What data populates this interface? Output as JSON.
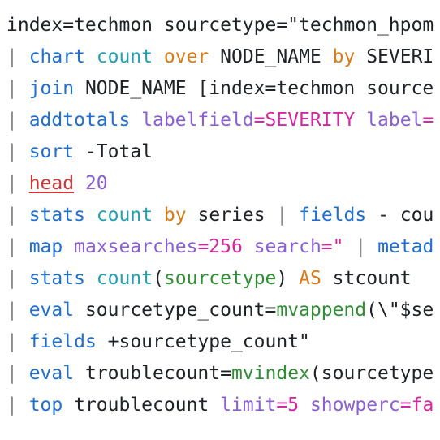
{
  "editor": {
    "lines": [
      {
        "tokens": [
          {
            "text": "index=techmon sourcetype=\"techmon_hpom",
            "role": "plain"
          }
        ]
      },
      {
        "tokens": [
          {
            "text": "| ",
            "role": "pipe"
          },
          {
            "text": "chart",
            "role": "cmd"
          },
          {
            "text": " ",
            "role": "plain"
          },
          {
            "text": "count",
            "role": "fn"
          },
          {
            "text": " ",
            "role": "plain"
          },
          {
            "text": "over",
            "role": "kw"
          },
          {
            "text": " NODE_NAME ",
            "role": "plain"
          },
          {
            "text": "by",
            "role": "kw"
          },
          {
            "text": " SEVERI",
            "role": "plain"
          }
        ]
      },
      {
        "tokens": [
          {
            "text": "| ",
            "role": "pipe"
          },
          {
            "text": "join",
            "role": "cmd"
          },
          {
            "text": " NODE_NAME [index=techmon source",
            "role": "plain"
          }
        ]
      },
      {
        "tokens": [
          {
            "text": "| ",
            "role": "pipe"
          },
          {
            "text": "addtotals",
            "role": "cmd"
          },
          {
            "text": " ",
            "role": "plain"
          },
          {
            "text": "labelfield",
            "role": "arg"
          },
          {
            "text": "=",
            "role": "op"
          },
          {
            "text": "SEVERITY",
            "role": "op"
          },
          {
            "text": " ",
            "role": "plain"
          },
          {
            "text": "label",
            "role": "arg"
          },
          {
            "text": "=",
            "role": "op"
          }
        ]
      },
      {
        "tokens": [
          {
            "text": "| ",
            "role": "pipe"
          },
          {
            "text": "sort",
            "role": "cmd"
          },
          {
            "text": " -Total",
            "role": "plain"
          }
        ]
      },
      {
        "tokens": [
          {
            "text": "| ",
            "role": "pipe"
          },
          {
            "text": "head",
            "role": "head"
          },
          {
            "text": " ",
            "role": "plain"
          },
          {
            "text": "20",
            "role": "num"
          }
        ]
      },
      {
        "tokens": [
          {
            "text": "| ",
            "role": "pipe"
          },
          {
            "text": "stats",
            "role": "cmd"
          },
          {
            "text": " ",
            "role": "plain"
          },
          {
            "text": "count",
            "role": "fn"
          },
          {
            "text": " ",
            "role": "plain"
          },
          {
            "text": "by",
            "role": "kw"
          },
          {
            "text": " series ",
            "role": "plain"
          },
          {
            "text": "|",
            "role": "pipe"
          },
          {
            "text": " ",
            "role": "plain"
          },
          {
            "text": "fields",
            "role": "cmd"
          },
          {
            "text": " - cou",
            "role": "plain"
          }
        ]
      },
      {
        "tokens": [
          {
            "text": "| ",
            "role": "pipe"
          },
          {
            "text": "map",
            "role": "cmd"
          },
          {
            "text": " ",
            "role": "plain"
          },
          {
            "text": "maxsearches",
            "role": "arg"
          },
          {
            "text": "=",
            "role": "op"
          },
          {
            "text": "256",
            "role": "op"
          },
          {
            "text": " ",
            "role": "plain"
          },
          {
            "text": "search",
            "role": "arg"
          },
          {
            "text": "=",
            "role": "op"
          },
          {
            "text": "\" ",
            "role": "op"
          },
          {
            "text": "|",
            "role": "pipe"
          },
          {
            "text": " ",
            "role": "plain"
          },
          {
            "text": "metad",
            "role": "cmd"
          }
        ]
      },
      {
        "tokens": [
          {
            "text": "| ",
            "role": "pipe"
          },
          {
            "text": "stats",
            "role": "cmd"
          },
          {
            "text": " ",
            "role": "plain"
          },
          {
            "text": "count",
            "role": "fn"
          },
          {
            "text": "(",
            "role": "plain"
          },
          {
            "text": "sourcetype",
            "role": "eval-fn"
          },
          {
            "text": ") ",
            "role": "plain"
          },
          {
            "text": "AS",
            "role": "kw"
          },
          {
            "text": " stcount",
            "role": "plain"
          }
        ]
      },
      {
        "tokens": [
          {
            "text": "| ",
            "role": "pipe"
          },
          {
            "text": "eval",
            "role": "cmd"
          },
          {
            "text": " sourcetype_count=",
            "role": "plain"
          },
          {
            "text": "mvappend",
            "role": "eval-fn"
          },
          {
            "text": "(\\\"$se",
            "role": "plain"
          }
        ]
      },
      {
        "tokens": [
          {
            "text": "| ",
            "role": "pipe"
          },
          {
            "text": "fields",
            "role": "cmd"
          },
          {
            "text": " +sourcetype_count\"",
            "role": "plain"
          }
        ]
      },
      {
        "tokens": [
          {
            "text": "| ",
            "role": "pipe"
          },
          {
            "text": "eval",
            "role": "cmd"
          },
          {
            "text": " troublecount=",
            "role": "plain"
          },
          {
            "text": "mvindex",
            "role": "eval-fn"
          },
          {
            "text": "(sourcetype",
            "role": "plain"
          }
        ]
      },
      {
        "tokens": [
          {
            "text": "| ",
            "role": "pipe"
          },
          {
            "text": "top",
            "role": "cmd"
          },
          {
            "text": " troublecount ",
            "role": "plain"
          },
          {
            "text": "limit",
            "role": "arg"
          },
          {
            "text": "=",
            "role": "op"
          },
          {
            "text": "5",
            "role": "op"
          },
          {
            "text": " ",
            "role": "plain"
          },
          {
            "text": "showperc",
            "role": "arg"
          },
          {
            "text": "=",
            "role": "op"
          },
          {
            "text": "fa",
            "role": "op"
          }
        ]
      }
    ]
  },
  "colors": {
    "pipe": "#8c8c8c",
    "command": "#1e6fd1",
    "function": "#20a0b0",
    "keyword": "#d97a14",
    "argument": "#8a5fd6",
    "operator_value": "#d726a3",
    "eval_function": "#2f8f33",
    "head_link": "#d03434",
    "text": "#1f2328",
    "background": "#ffffff"
  }
}
